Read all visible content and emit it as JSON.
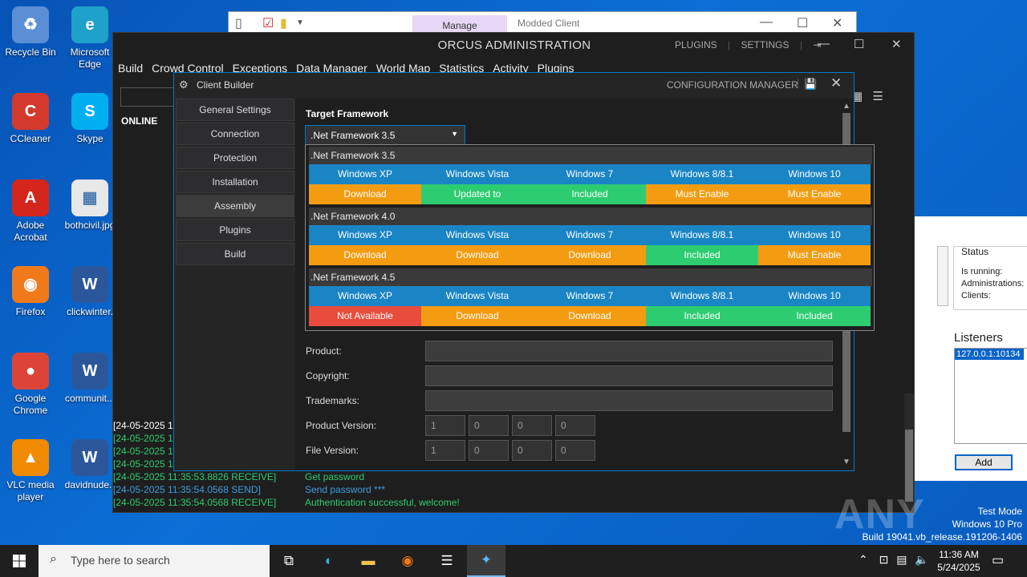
{
  "desktop": {
    "icons": [
      {
        "label": "Recycle Bin",
        "icon": "recycle-bin-icon",
        "glyph": "♻",
        "color": "#5a8fd6"
      },
      {
        "label": "Microsoft Edge",
        "icon": "edge-icon",
        "glyph": "e",
        "color": "#1fa2c9"
      },
      {
        "label": "CCleaner",
        "icon": "ccleaner-icon",
        "glyph": "C",
        "color": "#d33a2c"
      },
      {
        "label": "Skype",
        "icon": "skype-icon",
        "glyph": "S",
        "color": "#00aff0"
      },
      {
        "label": "Adobe Acrobat",
        "icon": "acrobat-icon",
        "glyph": "A",
        "color": "#d4261c"
      },
      {
        "label": "bothcivil.jpg",
        "icon": "image-file-icon",
        "glyph": "▦",
        "color": "#e8e8e8"
      },
      {
        "label": "Firefox",
        "icon": "firefox-icon",
        "glyph": "◉",
        "color": "#f07a1a"
      },
      {
        "label": "clickwinter.",
        "icon": "word-doc-icon",
        "glyph": "W",
        "color": "#2b579a"
      },
      {
        "label": "Google Chrome",
        "icon": "chrome-icon",
        "glyph": "●",
        "color": "#db4437"
      },
      {
        "label": "communit...",
        "icon": "word-doc-icon",
        "glyph": "W",
        "color": "#2b579a"
      },
      {
        "label": "VLC media player",
        "icon": "vlc-icon",
        "glyph": "▲",
        "color": "#f08a00"
      },
      {
        "label": "davidnude.r",
        "icon": "word-doc-icon",
        "glyph": "W",
        "color": "#2b579a"
      }
    ]
  },
  "explorer": {
    "manage_label": "Manage",
    "title": "Modded Client"
  },
  "right_panel": {
    "status_title": "Status",
    "is_running": "Is running:",
    "administrations": "Administrations:",
    "clients": "Clients:",
    "listeners_title": "Listeners",
    "listener_item": "127.0.0.1:10134",
    "add_button": "Add"
  },
  "orcus": {
    "title": "ORCUS ADMINISTRATION",
    "plugins_link": "PLUGINS",
    "settings_link": "SETTINGS",
    "menu": [
      "Build",
      "Crowd Control",
      "Exceptions",
      "Data Manager",
      "World Map",
      "Statistics",
      "Activity",
      "Plugins"
    ],
    "online_label": "ONLINE",
    "log": [
      {
        "time": "[24-05-2025 1",
        "msg": "",
        "color": "#ffffff"
      },
      {
        "time": "[24-05-2025 1",
        "msg": "",
        "color": "#2ecc71"
      },
      {
        "time": "[24-05-2025 1",
        "msg": "",
        "color": "#2ecc71"
      },
      {
        "time": "[24-05-2025 1",
        "msg": "",
        "color": "#2ecc71"
      },
      {
        "time": "[24-05-2025 11:35:53.8826 RECEIVE]",
        "msg": "Get password",
        "color": "#2ecc71"
      },
      {
        "time": "[24-05-2025 11:35:54.0568 SEND]",
        "msg": "Send password ***",
        "color": "#3a9de0"
      },
      {
        "time": "[24-05-2025 11:35:54.0568 RECEIVE]",
        "msg": "Authentication successful, welcome!",
        "color": "#2ecc71"
      }
    ]
  },
  "builder": {
    "title": "Client Builder",
    "config_manager": "CONFIGURATION MANAGER",
    "nav": [
      "General Settings",
      "Connection",
      "Protection",
      "Installation",
      "Assembly",
      "Plugins",
      "Build"
    ],
    "active_nav": "Assembly",
    "target_framework_label": "Target Framework",
    "target_framework_value": ".Net Framework 3.5",
    "fields": [
      {
        "label": "Product:"
      },
      {
        "label": "Copyright:"
      },
      {
        "label": "Trademarks:"
      }
    ],
    "product_version_label": "Product Version:",
    "product_version": [
      "1",
      "0",
      "0",
      "0"
    ],
    "file_version_label": "File Version:",
    "file_version": [
      "1",
      "0",
      "0",
      "0"
    ]
  },
  "frameworks": [
    {
      "name": ".Net Framework 3.5",
      "os": [
        "Windows XP",
        "Windows Vista",
        "Windows 7",
        "Windows 8/8.1",
        "Windows 10"
      ],
      "status": [
        {
          "text": "Download",
          "kind": "st-download"
        },
        {
          "text": "Updated to",
          "kind": "st-updated"
        },
        {
          "text": "Included",
          "kind": "st-included"
        },
        {
          "text": "Must Enable",
          "kind": "st-mustenable"
        },
        {
          "text": "Must Enable",
          "kind": "st-mustenable"
        }
      ]
    },
    {
      "name": ".Net Framework 4.0",
      "os": [
        "Windows XP",
        "Windows Vista",
        "Windows 7",
        "Windows 8/8.1",
        "Windows 10"
      ],
      "status": [
        {
          "text": "Download",
          "kind": "st-download"
        },
        {
          "text": "Download",
          "kind": "st-download"
        },
        {
          "text": "Download",
          "kind": "st-download"
        },
        {
          "text": "Included",
          "kind": "st-included"
        },
        {
          "text": "Must Enable",
          "kind": "st-mustenable"
        }
      ]
    },
    {
      "name": ".Net Framework 4.5",
      "os": [
        "Windows XP",
        "Windows Vista",
        "Windows 7",
        "Windows 8/8.1",
        "Windows 10"
      ],
      "status": [
        {
          "text": "Not Available",
          "kind": "st-na"
        },
        {
          "text": "Download",
          "kind": "st-download"
        },
        {
          "text": "Download",
          "kind": "st-download"
        },
        {
          "text": "Included",
          "kind": "st-included"
        },
        {
          "text": "Included",
          "kind": "st-included"
        }
      ]
    }
  ],
  "watermark": {
    "brand": "ANY RUN",
    "line1": "Test Mode",
    "line2": "Windows 10 Pro",
    "line3": "Build 19041.vb_release.191206-1406"
  },
  "taskbar": {
    "search_placeholder": "Type here to search",
    "time": "11:36 AM",
    "date": "5/24/2025"
  },
  "colors": {
    "accent": "#007acc",
    "os_header": "#1a85c5",
    "download": "#f39c12",
    "included": "#2ecc71",
    "not_available": "#e74c3c"
  }
}
